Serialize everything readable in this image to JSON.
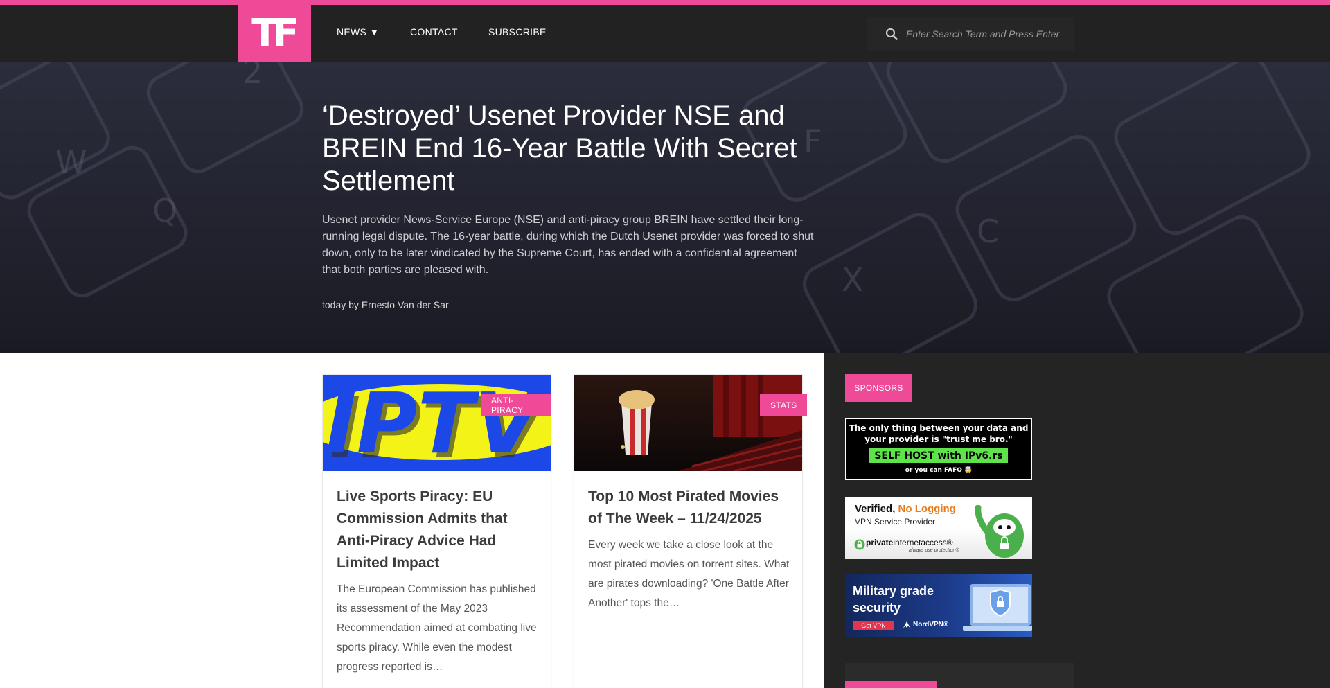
{
  "logo": {
    "text": "TF"
  },
  "nav": {
    "items": [
      {
        "label": "NEWS ▼"
      },
      {
        "label": "CONTACT"
      },
      {
        "label": "SUBSCRIBE"
      }
    ]
  },
  "search": {
    "placeholder": "Enter Search Term and Press Enter",
    "icon": "search-icon"
  },
  "hero": {
    "title": "‘Destroyed’ Usenet Provider NSE and BREIN End 16-Year Battle With Secret Settlement",
    "excerpt": "Usenet provider News-Service Europe (NSE) and anti-piracy group BREIN have settled their long-running legal dispute. The 16-year battle, during which the Dutch Usenet provider was forced to shut down, only to be later vindicated by the Supreme Court, has ended with a confidential agreement that both parties are pleased with.",
    "meta": "today by Ernesto Van der Sar"
  },
  "articles": [
    {
      "category": "ANTI-PIRACY",
      "image_text": "IPTV",
      "title": "Live Sports Piracy: EU Commission Admits that Anti-Piracy Advice Had Limited Impact",
      "excerpt": "The European Commission has published its assessment of the May 2023 Recommendation aimed at combating live sports piracy. While even the modest progress reported is…"
    },
    {
      "category": "STATS",
      "title": "Top 10 Most Pirated Movies of The Week – 11/24/2025",
      "excerpt": "Every week we take a close look at the most pirated movies on torrent sites. What are pirates downloading? 'One Battle After Another' tops the…"
    }
  ],
  "sidebar": {
    "sponsors_label": "SPONSORS",
    "ads": [
      {
        "line1": "The only thing between your data and your provider is \"trust me bro.\"",
        "button": "SELF HOST with IPv6.rs",
        "line3": "or you can FAFO 🤯"
      },
      {
        "headline_a": "Verified,",
        "headline_b": "No Logging",
        "sub": "VPN Service Provider",
        "brand_a": "private",
        "brand_b": "internetaccess®",
        "tagline": "always use protection®"
      },
      {
        "headline": "Military grade security",
        "button": "Get VPN",
        "brand": "NordVPN®"
      }
    ]
  },
  "colors": {
    "accent": "#ee4a97",
    "nav_bg": "#222222",
    "sidebar_bg": "#242424"
  }
}
